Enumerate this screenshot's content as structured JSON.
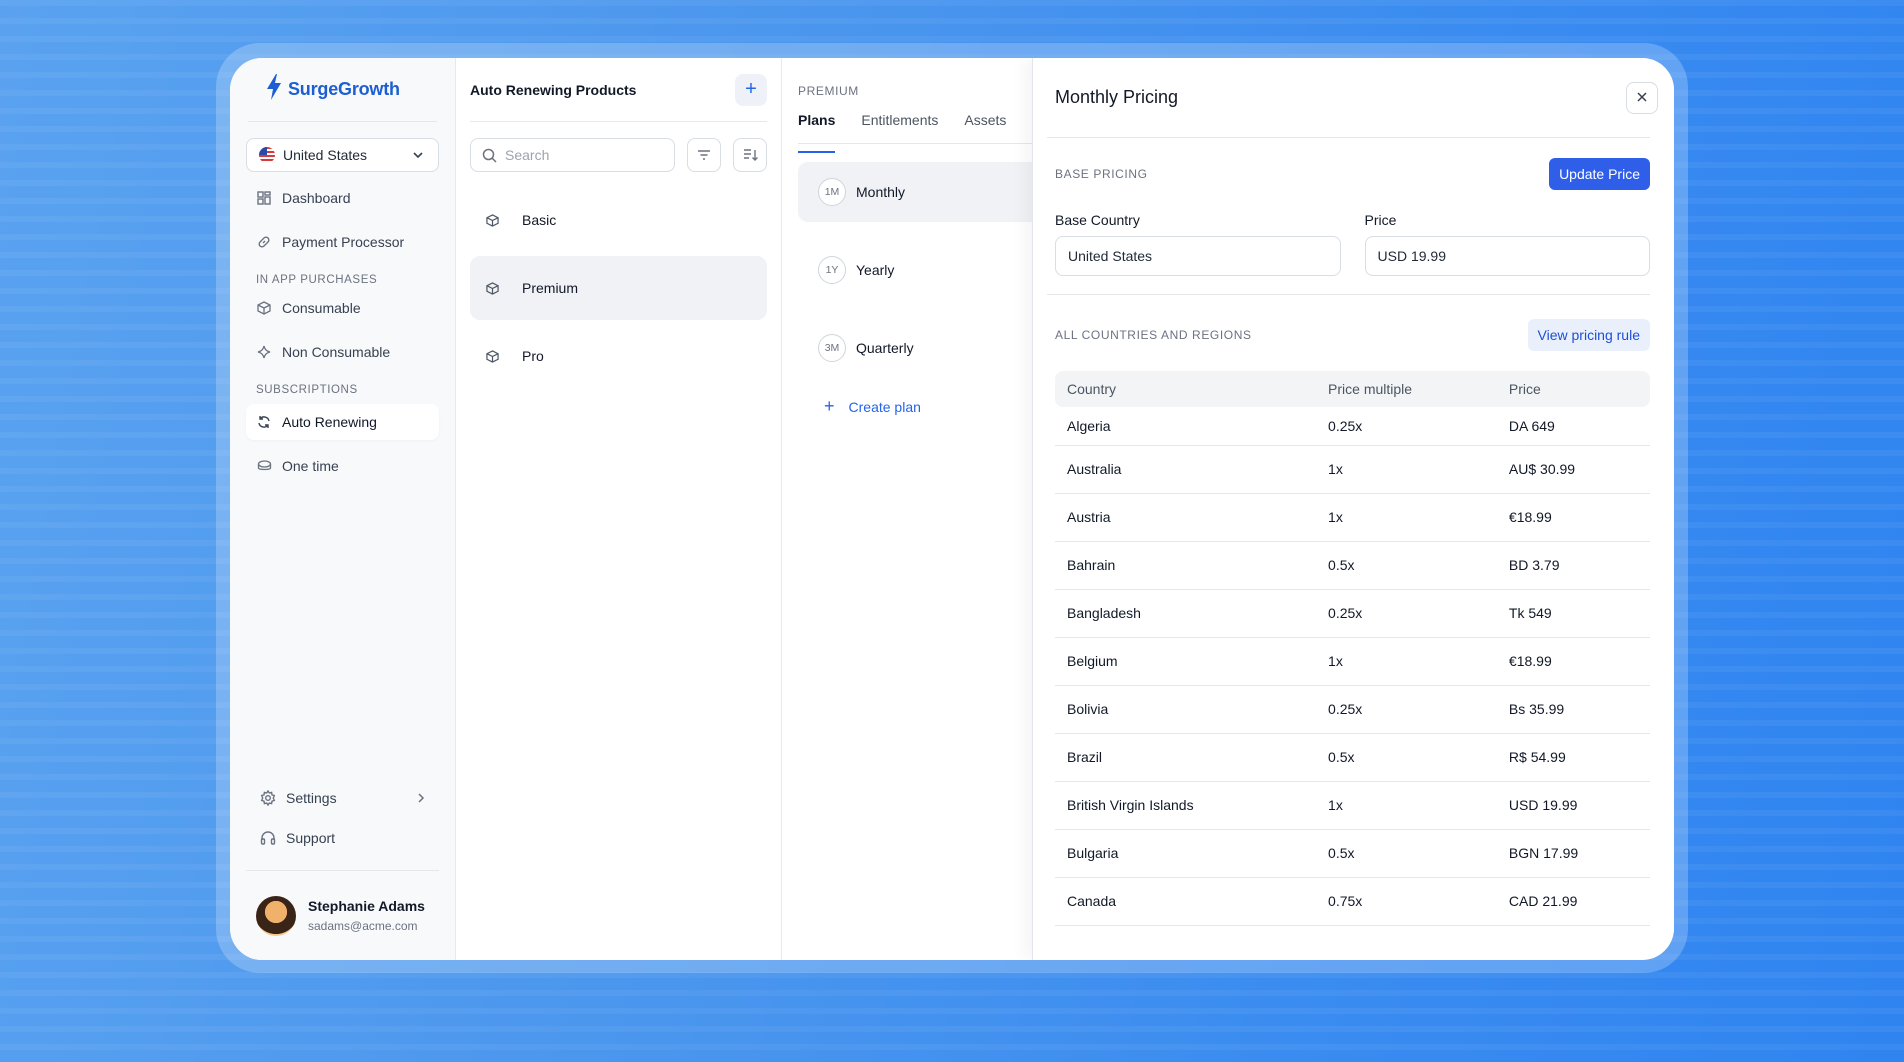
{
  "brand": {
    "name": "SurgeGrowth",
    "accent": "#2563eb"
  },
  "sidebar": {
    "country": "United States",
    "nav": [
      {
        "label": "Dashboard",
        "icon": "grid-icon"
      },
      {
        "label": "Payment Processor",
        "icon": "link-icon"
      }
    ],
    "section_iap": "IN APP PURCHASES",
    "iap_items": [
      {
        "label": "Consumable",
        "icon": "cube-icon"
      },
      {
        "label": "Non Consumable",
        "icon": "sparkle-icon"
      }
    ],
    "section_subs": "SUBSCRIPTIONS",
    "sub_items": [
      {
        "label": "Auto Renewing",
        "icon": "refresh-icon",
        "active": true
      },
      {
        "label": "One time",
        "icon": "coins-icon"
      }
    ],
    "settings": "Settings",
    "support": "Support",
    "user": {
      "name": "Stephanie Adams",
      "email": "sadams@acme.com"
    }
  },
  "products": {
    "title": "Auto Renewing Products",
    "search_placeholder": "Search",
    "items": [
      "Basic",
      "Premium",
      "Pro"
    ],
    "active": "Premium"
  },
  "plans": {
    "eyebrow": "PREMIUM",
    "tabs": [
      "Plans",
      "Entitlements",
      "Assets"
    ],
    "active_tab": "Plans",
    "items": [
      {
        "badge": "1M",
        "label": "Monthly"
      },
      {
        "badge": "1Y",
        "label": "Yearly"
      },
      {
        "badge": "3M",
        "label": "Quarterly"
      }
    ],
    "create_label": "Create plan"
  },
  "pricing": {
    "title": "Monthly Pricing",
    "base_eyebrow": "BASE PRICING",
    "update_label": "Update Price",
    "base_country_label": "Base Country",
    "base_country_value": "United States",
    "price_label": "Price",
    "price_value": "USD 19.99",
    "all_eyebrow": "ALL COUNTRIES AND REGIONS",
    "view_rule_label": "View pricing rule",
    "columns": [
      "Country",
      "Price multiple",
      "Price"
    ],
    "rows": [
      [
        "Algeria",
        "0.25x",
        "DA 649"
      ],
      [
        "Australia",
        "1x",
        "AU$ 30.99"
      ],
      [
        "Austria",
        "1x",
        "€18.99"
      ],
      [
        "Bahrain",
        "0.5x",
        "BD 3.79"
      ],
      [
        "Bangladesh",
        "0.25x",
        "Tk 549"
      ],
      [
        "Belgium",
        "1x",
        "€18.99"
      ],
      [
        "Bolivia",
        "0.25x",
        "Bs 35.99"
      ],
      [
        "Brazil",
        "0.5x",
        "R$ 54.99"
      ],
      [
        "British Virgin Islands",
        "1x",
        "USD 19.99"
      ],
      [
        "Bulgaria",
        "0.5x",
        "BGN 17.99"
      ],
      [
        "Canada",
        "0.75x",
        "CAD 21.99"
      ]
    ]
  }
}
